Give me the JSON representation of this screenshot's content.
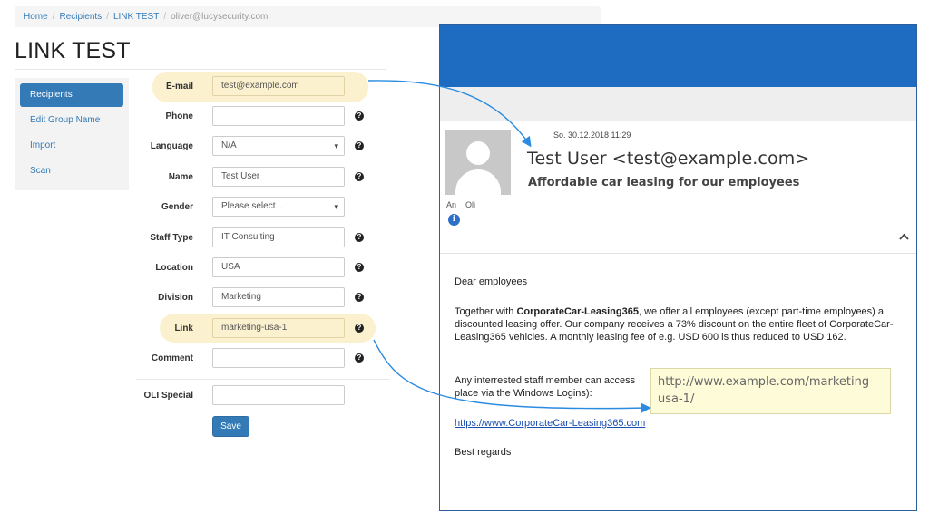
{
  "breadcrumb": {
    "home": "Home",
    "recipients": "Recipients",
    "group": "LINK TEST",
    "current": "oliver@lucysecurity.com",
    "separator": "/"
  },
  "page_title": "LINK TEST",
  "sidebar": {
    "items": [
      {
        "label": "Recipients"
      },
      {
        "label": "Edit Group Name"
      },
      {
        "label": "Import"
      },
      {
        "label": "Scan"
      }
    ]
  },
  "form": {
    "email": {
      "label": "E-mail",
      "value": "test@example.com"
    },
    "phone": {
      "label": "Phone",
      "value": ""
    },
    "language": {
      "label": "Language",
      "value": "N/A"
    },
    "name": {
      "label": "Name",
      "value": "Test User"
    },
    "gender": {
      "label": "Gender",
      "value": "Please select..."
    },
    "staff_type": {
      "label": "Staff Type",
      "value": "IT Consulting"
    },
    "location": {
      "label": "Location",
      "value": "USA"
    },
    "division": {
      "label": "Division",
      "value": "Marketing"
    },
    "link": {
      "label": "Link",
      "value": "marketing-usa-1"
    },
    "comment": {
      "label": "Comment",
      "value": ""
    },
    "oli_special": {
      "label": "OLI Special",
      "value": ""
    },
    "save_label": "Save",
    "help_glyph": "?"
  },
  "email": {
    "date": "So. 30.12.2018 11:29",
    "from": "Test User <test@example.com>",
    "subject": "Affordable car leasing for our employees",
    "to_label": "An",
    "to_value": "Oli",
    "info_glyph": "i",
    "collapse_glyph": "^",
    "greeting": "Dear employees",
    "para1_prefix": "Together with ",
    "para1_company": "CorporateCar-Leasing365",
    "para1_rest": ", we offer all employees (except part-time employees) a discounted leasing offer. Our company receives a 73% discount on the entire fleet of CorporateCar-Leasing365 vehicles. A monthly leasing fee of e.g. USD 600 is thus reduced to USD 162.",
    "para2_line1": "Any interrested staff member can access",
    "para2_line2": "place via the Windows Logins):",
    "link_text": "https://www.CorporateCar-Leasing365.com",
    "closing": "Best regards",
    "tooltip_url": "http://www.example.com/marketing-usa-1/"
  },
  "colors": {
    "highlight": "#fbf1cf",
    "accent_blue": "#337ab7",
    "email_header_blue": "#1e6cc1",
    "arrow_blue": "#2a8be0"
  }
}
